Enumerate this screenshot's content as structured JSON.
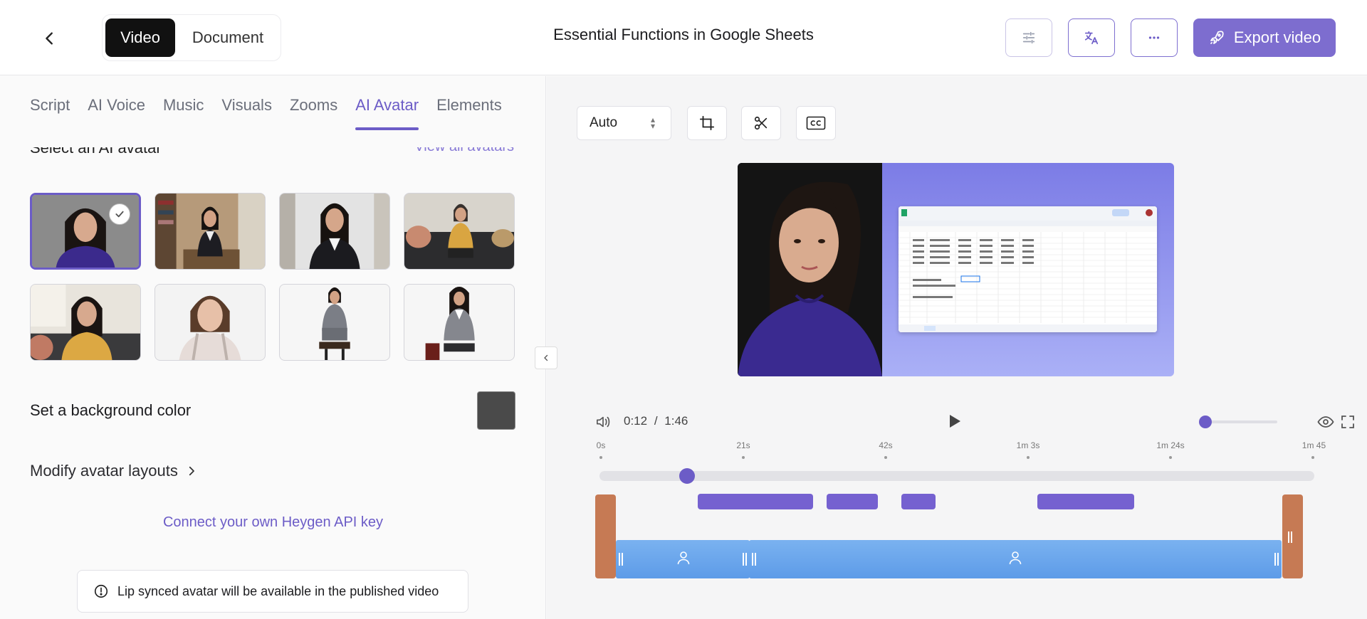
{
  "header": {
    "back_icon": "chevron-left-icon",
    "mode_tabs": [
      "Video",
      "Document"
    ],
    "title": "Essential Functions in Google Sheets",
    "buttons": [
      "sliders-icon",
      "translate-icon",
      "more-icon"
    ],
    "export_label": "Export video",
    "export_icon": "rocket-icon",
    "accent_color": "#7d6dcf"
  },
  "left": {
    "tabs": [
      "Script",
      "AI Voice",
      "Music",
      "Visuals",
      "Zooms",
      "AI Avatar",
      "Elements"
    ],
    "active_tab": "AI Avatar",
    "section_title": "Select an AI avatar",
    "view_all": "View all avatars",
    "avatars_selected_index": 0,
    "bg_color_label": "Set a background color",
    "bg_color_value": "#4a4a4a",
    "modify_layouts": "Modify avatar layouts",
    "connect_link": "Connect your own Heygen API key",
    "notice": "Lip synced avatar will be available in the published video"
  },
  "right": {
    "aspect_select": "Auto",
    "tools": [
      "crop-icon",
      "scissors-icon",
      "captions-icon"
    ],
    "time_current": "0:12",
    "time_sep": "/",
    "time_total": "1:46",
    "ruler": [
      "0s",
      "21s",
      "42s",
      "1m 3s",
      "1m 24s",
      "1m 45"
    ]
  }
}
